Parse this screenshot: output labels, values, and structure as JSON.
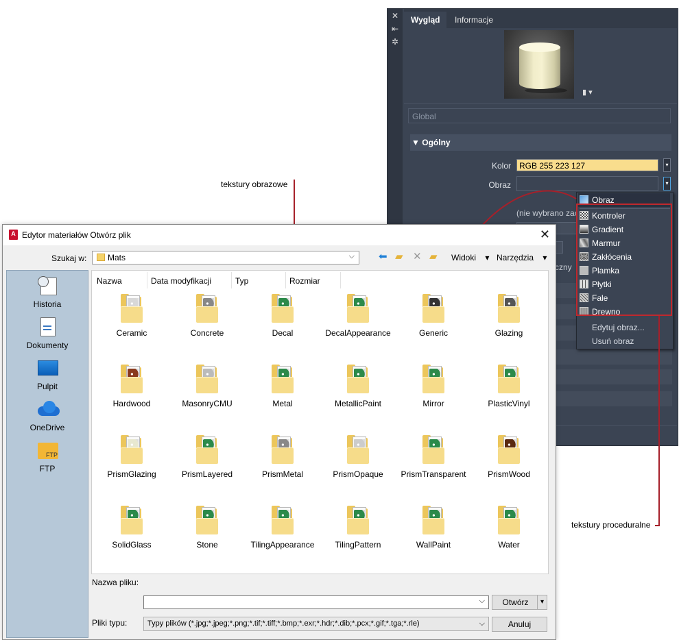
{
  "materials_panel": {
    "tabs": [
      "Wygląd",
      "Informacje"
    ],
    "global_field": "Global",
    "section_title": "Ogólny",
    "color_label": "Kolor",
    "color_value": "RGB 255 223 127",
    "image_label": "Obraz",
    "no_image_partial": "(nie wybrano zac",
    "partial_text": "czny",
    "swatch_color": "#ffdf7f"
  },
  "texture_menu": {
    "selected": "Obraz",
    "procedural": [
      "Kontroler",
      "Gradient",
      "Marmur",
      "Zakłócenia",
      "Plamka",
      "Płytki",
      "Fale",
      "Drewno"
    ],
    "actions": [
      "Edytuj obraz...",
      "Usuń obraz"
    ]
  },
  "annotations": {
    "image_textures": "tekstury obrazowe",
    "procedural_textures": "tekstury proceduralne",
    "callout_color": "#a6202a"
  },
  "file_dialog": {
    "title": "Edytor materiałów Otwórz plik",
    "look_in_label": "Szukaj w:",
    "look_in_value": "Mats",
    "views_label": "Widoki",
    "tools_label": "Narzędzia",
    "columns": [
      "Nazwa",
      "Data modyfikacji",
      "Typ",
      "Rozmiar"
    ],
    "places": [
      "Historia",
      "Dokumenty",
      "Pulpit",
      "OneDrive",
      "FTP"
    ],
    "items": [
      "Ceramic",
      "Concrete",
      "Decal",
      "DecalAppearance",
      "Generic",
      "Glazing",
      "Hardwood",
      "MasonryCMU",
      "Metal",
      "MetallicPaint",
      "Mirror",
      "PlasticVinyl",
      "PrismGlazing",
      "PrismLayered",
      "PrismMetal",
      "PrismOpaque",
      "PrismTransparent",
      "PrismWood",
      "SolidGlass",
      "Stone",
      "TilingAppearance",
      "TilingPattern",
      "WallPaint",
      "Water"
    ],
    "file_name_label": "Nazwa pliku:",
    "file_name_value": "",
    "file_type_label": "Pliki typu:",
    "file_type_value": "Typy plików  (*.jpg;*.jpeg;*.png;*.tif;*.tiff;*.bmp;*.exr;*.hdr;*.dib;*.pcx;*.gif;*.tga;*.rle)",
    "open_button": "Otwórz",
    "cancel_button": "Anuluj"
  }
}
